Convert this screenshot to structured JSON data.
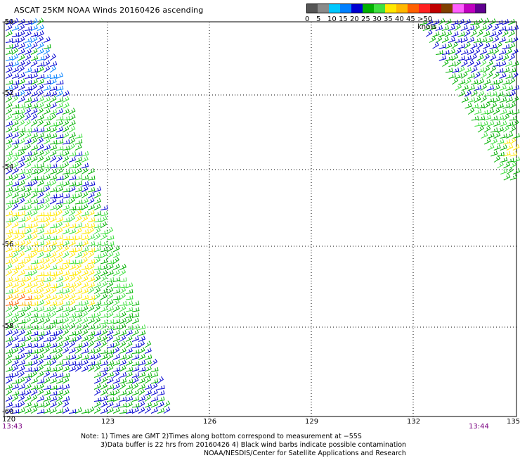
{
  "title": "ASCAT 25KM NOAA Winds 20160426 ascending",
  "legend": {
    "colors": [
      "#555555",
      "#8a8a8a",
      "#00c8ff",
      "#0080ff",
      "#0000d0",
      "#00b000",
      "#40e040",
      "#ffe800",
      "#ffb800",
      "#ff6000",
      "#ff2020",
      "#c00000",
      "#804000",
      "#ff60ff",
      "#c000c0",
      "#600090"
    ],
    "labels": [
      "0",
      "5",
      "10",
      "15",
      "20",
      "25",
      "30",
      "35",
      "40",
      "45",
      ">50 knots"
    ],
    "label_index": [
      0,
      2,
      4,
      6,
      8,
      10,
      12,
      14,
      16,
      18,
      20
    ]
  },
  "axes": {
    "lon_ticks": [
      "123",
      "126",
      "129",
      "132",
      "135"
    ],
    "lat_ticks": [
      "-50",
      "-52",
      "-54",
      "-56",
      "-58",
      "-60"
    ],
    "corner_lon": "120",
    "time_left": "13:43",
    "time_right": "13:44"
  },
  "notes": [
    "Note: 1) Times are GMT 2)Times along bottom correspond to measurement at −55S",
    "3)Data buffer is 22 hrs from 20160426 4) Black wind barbs indicate possible contamination",
    "NOAA/NESDIS/Center for Satellite Applications and Research"
  ]
}
